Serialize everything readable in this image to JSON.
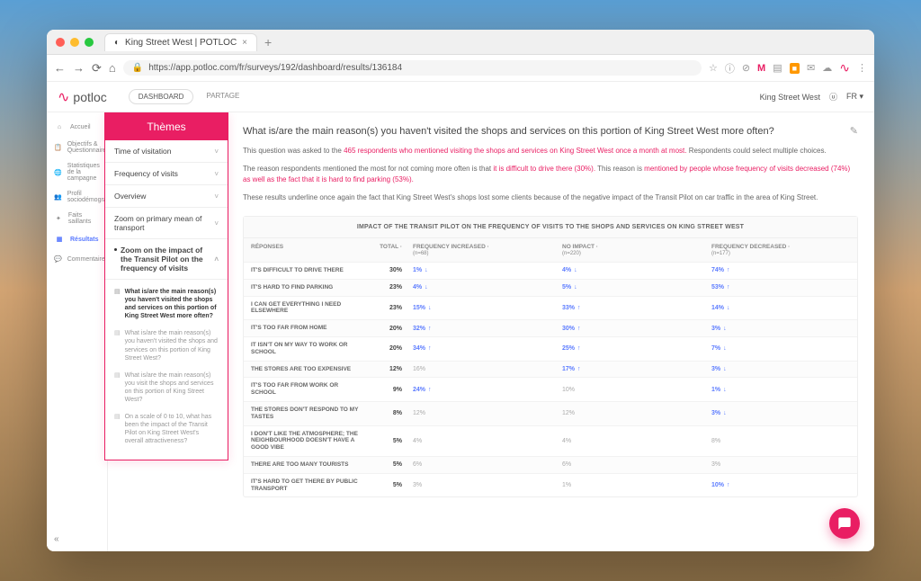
{
  "browser": {
    "tab_title": "King Street West | POTLOC",
    "url": "https://app.potloc.com/fr/surveys/192/dashboard/results/136184"
  },
  "header": {
    "brand": "potloc",
    "tabs": [
      "DASHBOARD",
      "PARTAGE"
    ],
    "project": "King Street West",
    "lang": "FR"
  },
  "leftnav": {
    "items": [
      {
        "label": "Accueil"
      },
      {
        "label": "Objectifs & Questionnaire"
      },
      {
        "label": "Statistiques de la campagne"
      },
      {
        "label": "Profil sociodémographique"
      },
      {
        "label": "Faits saillants"
      },
      {
        "label": "Résultats"
      },
      {
        "label": "Commentaires"
      }
    ]
  },
  "themes": {
    "title": "Thèmes",
    "items": [
      {
        "label": "Time of visitation"
      },
      {
        "label": "Frequency of visits"
      },
      {
        "label": "Overview"
      },
      {
        "label": "Zoom on primary mean of transport"
      },
      {
        "label": "Zoom on the impact of the Transit Pilot on the frequency of visits"
      }
    ],
    "subs": [
      {
        "label": "What is/are the main reason(s) you haven't visited the shops and services on this portion of King Street West more often?",
        "active": true
      },
      {
        "label": "What is/are the main reason(s) you haven't visited the shops and services on this portion of King Street West?",
        "active": false
      },
      {
        "label": "What is/are the main reason(s) you visit the shops and services on this portion of King Street West?",
        "active": false
      },
      {
        "label": "On a scale of 0 to 10, what has been the impact of the Transit Pilot on King Street West's overall attractiveness?",
        "active": false
      }
    ]
  },
  "question": {
    "title": "What is/are the main reason(s) you haven't visited the shops and services on this portion of King Street West more often?",
    "p1a": "This question was asked to the ",
    "p1b": "465 respondents who mentioned visiting the shops and services on King Street West once a month at most.",
    "p1c": " Respondents could select multiple choices.",
    "p2a": "The reason respondents mentioned the most for not coming more often is that ",
    "p2b": "it is difficult to drive there (30%).",
    "p2c": " This reason is ",
    "p2d": "mentioned by people whose frequency of visits decreased (74%) as well as the fact that it is hard to find parking (53%).",
    "p3": "These results underline once again the fact that King Street West's shops lost some clients because of the negative impact of the Transit Pilot on car traffic in the area of King Street."
  },
  "table": {
    "caption": "IMPACT OF THE TRANSIT PILOT ON THE FREQUENCY OF VISITS TO THE SHOPS AND SERVICES ON KING STREET WEST",
    "headers": {
      "responses": "RÉPONSES",
      "total": "TOTAL",
      "inc": "FREQUENCY INCREASED",
      "inc_n": "(n=68)",
      "noimp": "NO IMPACT",
      "noimp_n": "(n=220)",
      "dec": "FREQUENCY DECREASED",
      "dec_n": "(n=177)"
    },
    "rows": [
      {
        "r": "IT'S DIFFICULT TO DRIVE THERE",
        "t": "30%",
        "a": "1%",
        "ad": "↓",
        "b": "4%",
        "bd": "↓",
        "c": "74%",
        "cd": "↑"
      },
      {
        "r": "IT'S HARD TO FIND PARKING",
        "t": "23%",
        "a": "4%",
        "ad": "↓",
        "b": "5%",
        "bd": "↓",
        "c": "53%",
        "cd": "↑"
      },
      {
        "r": "I CAN GET EVERYTHING I NEED ELSEWHERE",
        "t": "23%",
        "a": "15%",
        "ad": "↓",
        "b": "33%",
        "bd": "↑",
        "c": "14%",
        "cd": "↓"
      },
      {
        "r": "IT'S TOO FAR FROM HOME",
        "t": "20%",
        "a": "32%",
        "ad": "↑",
        "b": "30%",
        "bd": "↑",
        "c": "3%",
        "cd": "↓"
      },
      {
        "r": "IT ISN'T ON MY WAY TO WORK OR SCHOOL",
        "t": "20%",
        "a": "34%",
        "ad": "↑",
        "b": "25%",
        "bd": "↑",
        "c": "7%",
        "cd": "↓"
      },
      {
        "r": "THE STORES ARE TOO EXPENSIVE",
        "t": "12%",
        "a": "16%",
        "ad": "",
        "b": "17%",
        "bd": "↑",
        "c": "3%",
        "cd": "↓"
      },
      {
        "r": "IT'S TOO FAR FROM WORK OR SCHOOL",
        "t": "9%",
        "a": "24%",
        "ad": "↑",
        "b": "10%",
        "bd": "",
        "c": "1%",
        "cd": "↓"
      },
      {
        "r": "THE STORES DON'T RESPOND TO MY TASTES",
        "t": "8%",
        "a": "12%",
        "ad": "",
        "b": "12%",
        "bd": "",
        "c": "3%",
        "cd": "↓"
      },
      {
        "r": "I DON'T LIKE THE ATMOSPHERE; THE NEIGHBOURHOOD DOESN'T HAVE A GOOD VIBE",
        "t": "5%",
        "a": "4%",
        "ad": "",
        "b": "4%",
        "bd": "",
        "c": "8%",
        "cd": ""
      },
      {
        "r": "THERE ARE TOO MANY TOURISTS",
        "t": "5%",
        "a": "6%",
        "ad": "",
        "b": "6%",
        "bd": "",
        "c": "3%",
        "cd": ""
      },
      {
        "r": "IT'S HARD TO GET THERE BY PUBLIC TRANSPORT",
        "t": "5%",
        "a": "3%",
        "ad": "",
        "b": "1%",
        "bd": "",
        "c": "10%",
        "cd": "↑"
      }
    ]
  }
}
